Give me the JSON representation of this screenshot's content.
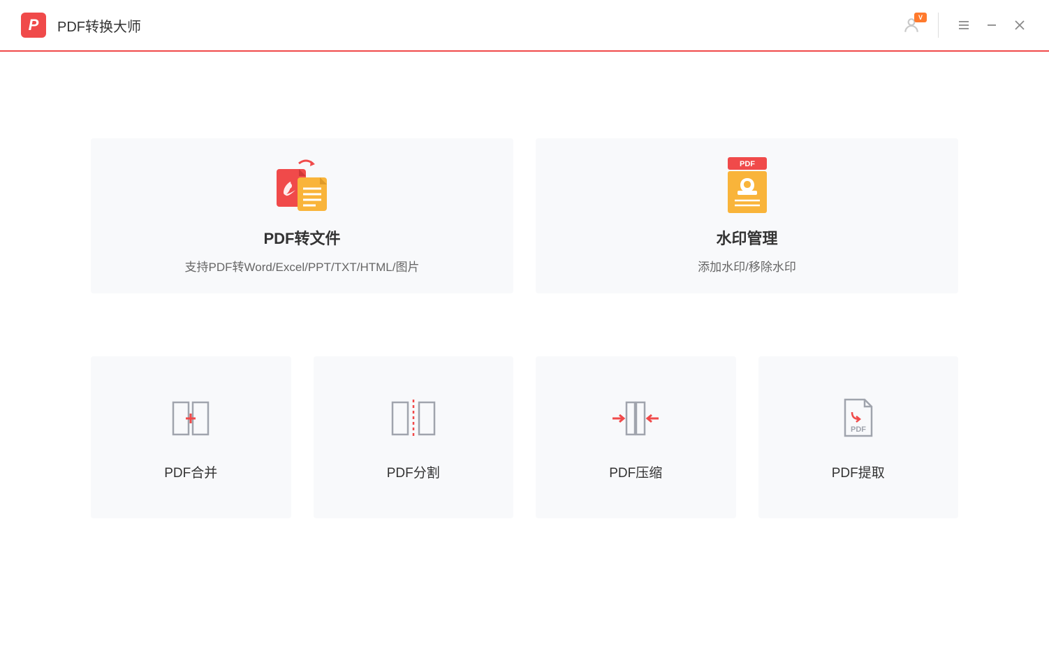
{
  "header": {
    "app_title": "PDF转换大师",
    "vip_label": "V"
  },
  "main_cards": [
    {
      "title": "PDF转文件",
      "desc": "支持PDF转Word/Excel/PPT/TXT/HTML/图片"
    },
    {
      "title": "水印管理",
      "desc": "添加水印/移除水印"
    }
  ],
  "tool_cards": [
    {
      "title": "PDF合并"
    },
    {
      "title": "PDF分割"
    },
    {
      "title": "PDF压缩"
    },
    {
      "title": "PDF提取"
    }
  ]
}
